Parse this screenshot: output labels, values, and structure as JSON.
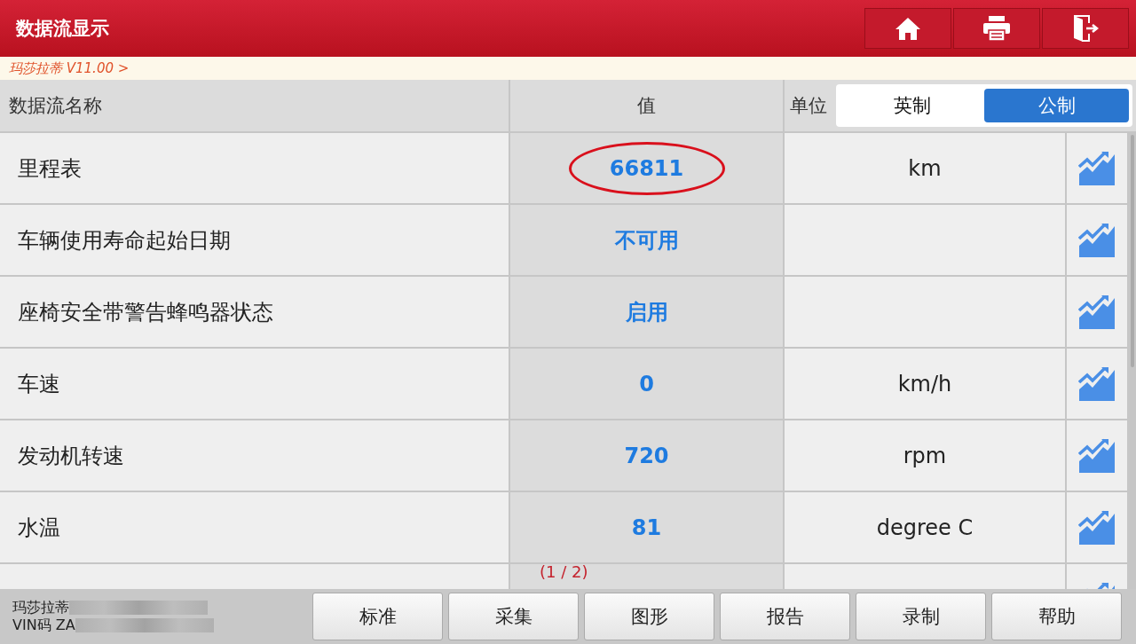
{
  "header": {
    "title": "数据流显示",
    "buttons": [
      {
        "kind": "home"
      },
      {
        "kind": "print"
      },
      {
        "kind": "exit"
      }
    ]
  },
  "breadcrumb": "玛莎拉蒂 V11.00 >",
  "columns": {
    "name": "数据流名称",
    "value": "值",
    "unit": "单位"
  },
  "unit_toggle": [
    {
      "label": "英制",
      "selected": false
    },
    {
      "label": "公制",
      "selected": true
    }
  ],
  "rows": [
    {
      "name": "里程表",
      "value": "66811",
      "unit": "km",
      "circled": true
    },
    {
      "name": "车辆使用寿命起始日期",
      "value": "不可用",
      "unit": "",
      "circled": false
    },
    {
      "name": "座椅安全带警告蜂鸣器状态",
      "value": "启用",
      "unit": "",
      "circled": false
    },
    {
      "name": "车速",
      "value": "0",
      "unit": "km/h",
      "circled": false
    },
    {
      "name": "发动机转速",
      "value": "720",
      "unit": "rpm",
      "circled": false
    },
    {
      "name": "水温",
      "value": "81",
      "unit": "degree C",
      "circled": false
    },
    {}
  ],
  "page_indicator": "(1 / 2)",
  "vehicle": {
    "make": "玛莎拉蒂",
    "vin_label": "VIN码 ZA"
  },
  "footer_buttons": [
    "标准",
    "采集",
    "图形",
    "报告",
    "录制",
    "帮助"
  ]
}
